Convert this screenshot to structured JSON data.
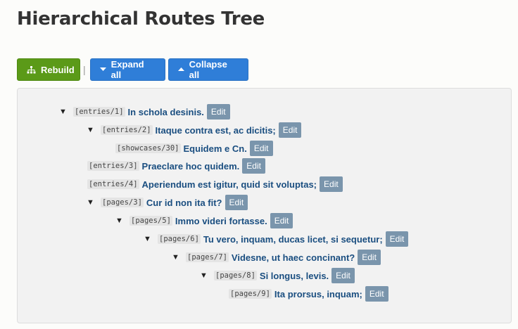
{
  "page": {
    "title": "Hierarchical Routes Tree"
  },
  "toolbar": {
    "rebuild_label": "Rebuild",
    "separator": "|",
    "expand_label": "Expand all",
    "collapse_label": "Collapse all"
  },
  "tree": {
    "toggle_expanded": "▼",
    "edit_label": "Edit",
    "nodes": [
      {
        "route": "[entries/1]",
        "title": "In schola desinis.",
        "expanded": true
      },
      {
        "route": "[entries/2]",
        "title": "Itaque contra est, ac dicitis;",
        "expanded": true
      },
      {
        "route": "[showcases/30]",
        "title": "Equidem e Cn."
      },
      {
        "route": "[entries/3]",
        "title": "Praeclare hoc quidem."
      },
      {
        "route": "[entries/4]",
        "title": "Aperiendum est igitur, quid sit voluptas;"
      },
      {
        "route": "[pages/3]",
        "title": "Cur id non ita fit?",
        "expanded": true
      },
      {
        "route": "[pages/5]",
        "title": "Immo videri fortasse.",
        "expanded": true
      },
      {
        "route": "[pages/6]",
        "title": "Tu vero, inquam, ducas licet, si sequetur;",
        "expanded": true
      },
      {
        "route": "[pages/7]",
        "title": "Videsne, ut haec concinant?",
        "expanded": true
      },
      {
        "route": "[pages/8]",
        "title": "Si longus, levis.",
        "expanded": true
      },
      {
        "route": "[pages/9]",
        "title": "Ita prorsus, inquam;"
      }
    ]
  },
  "colors": {
    "rebuild": "#5b9a18",
    "expand": "#2f7ed8",
    "collapse": "#2f7ed8",
    "edit": "#7a95ac",
    "link": "#1a4e80"
  }
}
